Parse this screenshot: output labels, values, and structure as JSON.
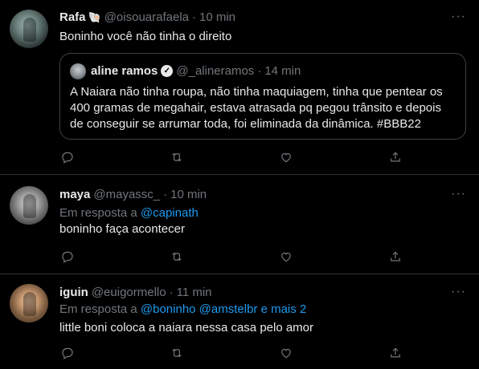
{
  "tweets": [
    {
      "name": "Rafa",
      "name_badge": "🐚",
      "handle": "@oisouarafaela",
      "dot": "·",
      "time": "10 min",
      "more": "···",
      "text": "Boninho você não tinha o direito",
      "quote": {
        "name": "aline ramos",
        "verified": "✓",
        "handle": "@_alineramos",
        "dot": "·",
        "time": "14 min",
        "text": "A Naiara não tinha roupa, não tinha maquiagem, tinha que pentear os 400 gramas de megahair, estava atrasada pq pegou trânsito e depois de conseguir se arrumar toda, foi eliminada da dinâmica. #BBB22"
      }
    },
    {
      "name": "maya",
      "handle": "@mayassc_",
      "dot": "·",
      "time": "10 min",
      "more": "···",
      "reply_prefix": "Em resposta a",
      "reply_mentions": "@capinath",
      "text": "boninho faça acontecer"
    },
    {
      "name": "iguin",
      "handle": "@euigormello",
      "dot": "·",
      "time": "11 min",
      "more": "···",
      "reply_prefix": "Em resposta a",
      "reply_mentions": "@boninho @amstelbr e mais 2",
      "text": "little boni coloca a naiara nessa casa pelo amor"
    }
  ],
  "icons": [
    "reply-icon",
    "retweet-icon",
    "like-icon",
    "share-icon"
  ],
  "colors": {
    "background": "#000000",
    "text": "#e7e9ea",
    "muted": "#71767b",
    "link": "#1d9bf0",
    "divider": "#2f3336"
  }
}
